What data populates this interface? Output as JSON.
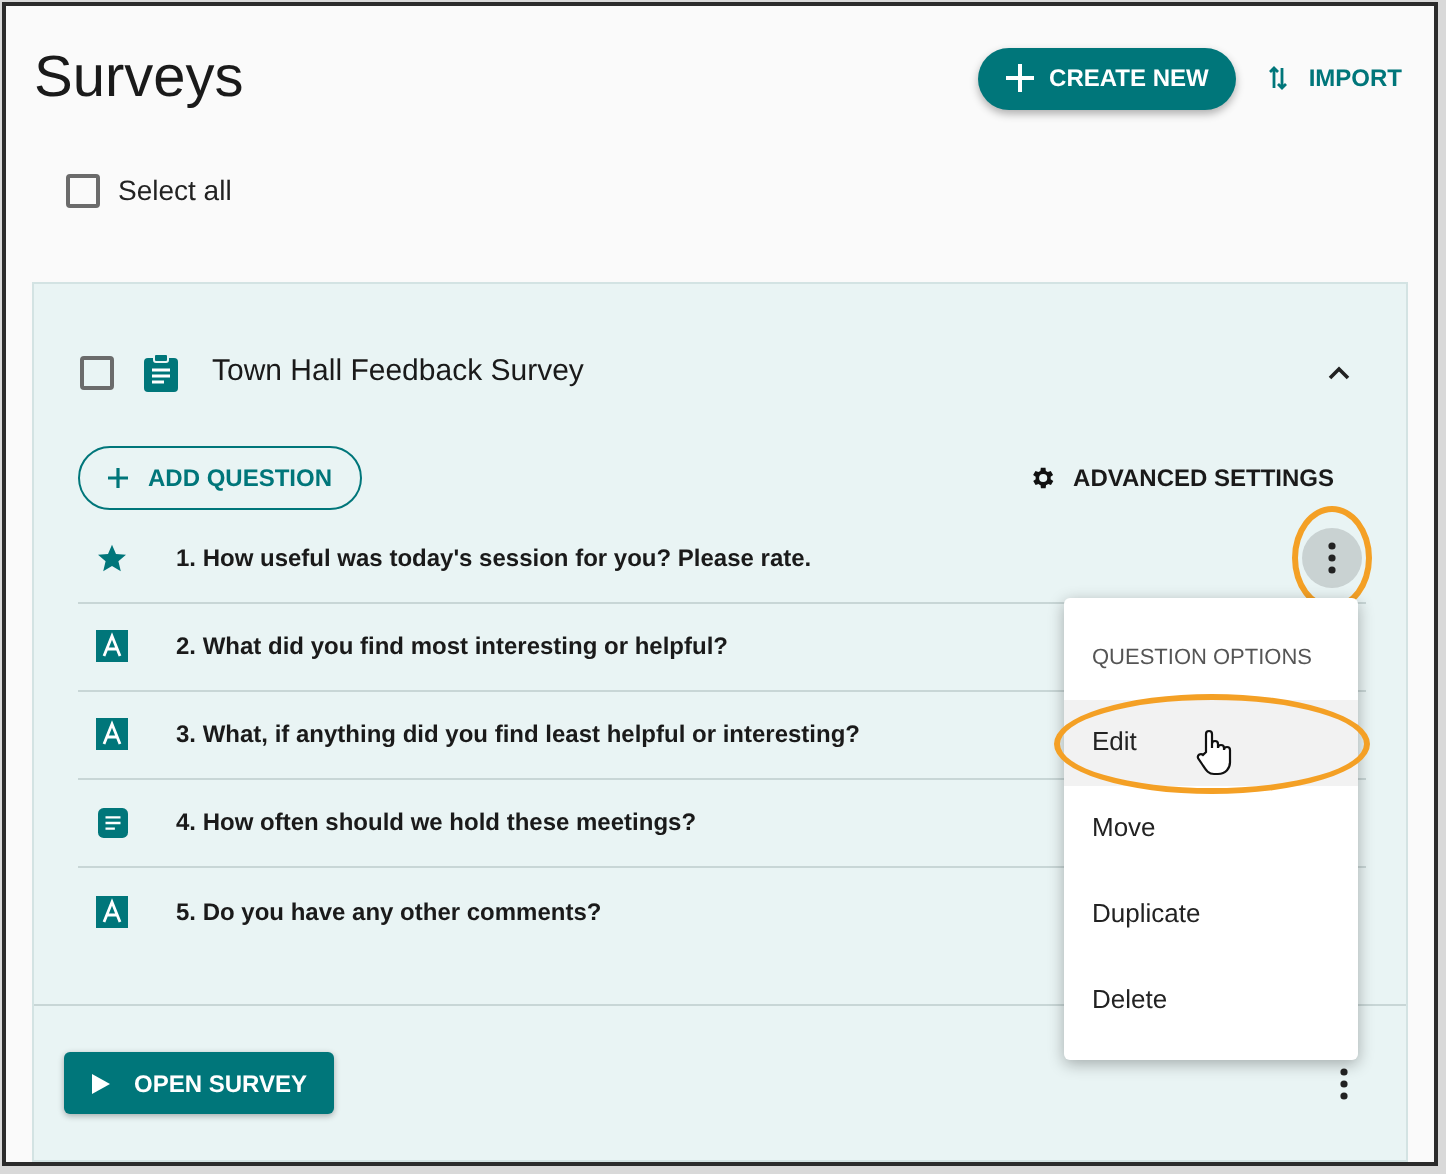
{
  "page": {
    "title": "Surveys"
  },
  "header_actions": [
    {
      "kind": "primary",
      "label": "CREATE NEW"
    },
    {
      "kind": "link",
      "label": "IMPORT"
    }
  ],
  "select_all": {
    "label": "Select all",
    "checked": false
  },
  "survey": {
    "checked": false,
    "expanded": true,
    "name": "Town Hall Feedback Survey",
    "add_question": "ADD QUESTION",
    "advanced_settings": "ADVANCED SETTINGS",
    "questions": [
      {
        "kind": "rating",
        "text": "1. How useful was today's session for you? Please rate.",
        "menu_open": true,
        "highlighted": true
      },
      {
        "kind": "text",
        "text": "2. What did you find most interesting or helpful?",
        "menu_open": false,
        "highlighted": false
      },
      {
        "kind": "text",
        "text": "3. What, if anything did you find least helpful or interesting?",
        "menu_open": false,
        "highlighted": false
      },
      {
        "kind": "list",
        "text": "4. How often should we hold these meetings?",
        "menu_open": false,
        "highlighted": false
      },
      {
        "kind": "text",
        "text": "5. Do you have any other comments?",
        "menu_open": false,
        "highlighted": false
      }
    ],
    "open_survey": "OPEN SURVEY"
  },
  "question_menu": {
    "header": "QUESTION OPTIONS",
    "items": [
      {
        "label": "Edit",
        "selected": true,
        "highlighted": true
      },
      {
        "label": "Move",
        "selected": false,
        "highlighted": false
      },
      {
        "label": "Duplicate",
        "selected": false,
        "highlighted": false
      },
      {
        "label": "Delete",
        "selected": false,
        "highlighted": false
      }
    ]
  }
}
